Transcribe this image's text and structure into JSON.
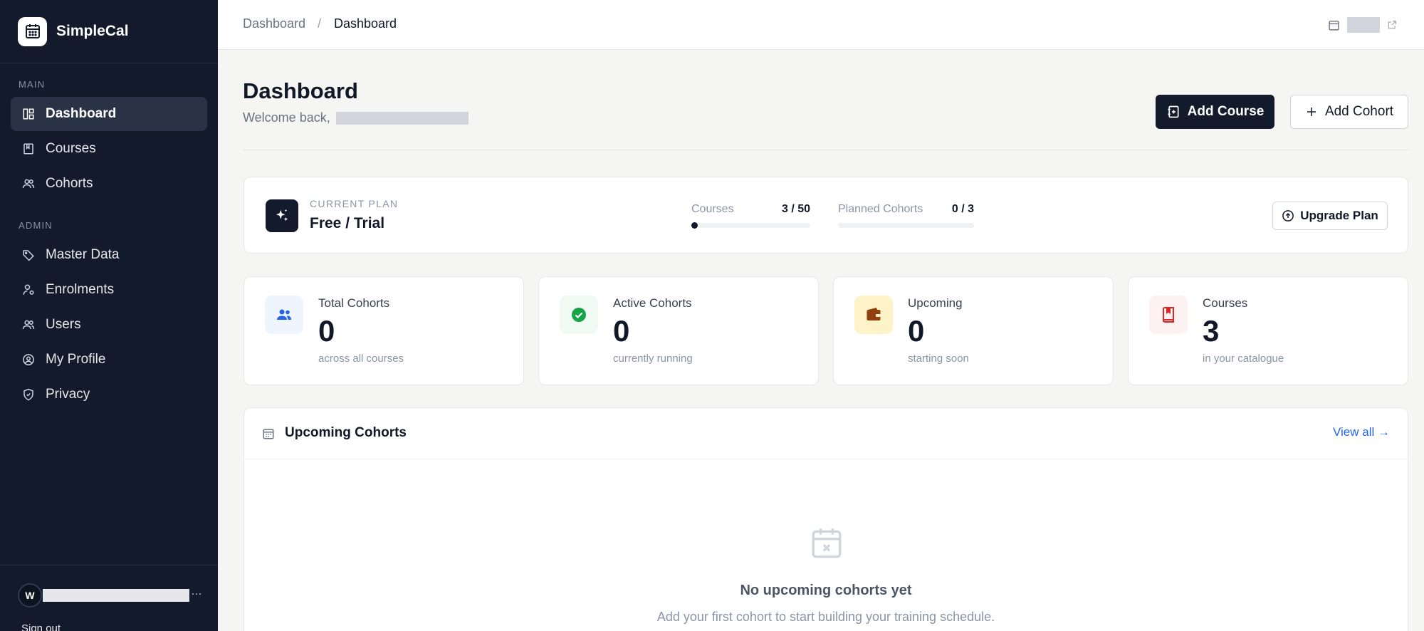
{
  "app": {
    "name": "SimpleCal"
  },
  "sidebar": {
    "sections": {
      "main": "MAIN",
      "admin": "ADMIN"
    },
    "main_items": [
      {
        "label": "Dashboard",
        "icon": "layout-dashboard-icon",
        "active": true
      },
      {
        "label": "Courses",
        "icon": "book-icon"
      },
      {
        "label": "Cohorts",
        "icon": "users-icon"
      }
    ],
    "admin_items": [
      {
        "label": "Master Data",
        "icon": "tag-icon"
      },
      {
        "label": "Enrolments",
        "icon": "user-check-icon"
      },
      {
        "label": "Users",
        "icon": "users-icon"
      },
      {
        "label": "My Profile",
        "icon": "user-circle-icon"
      },
      {
        "label": "Privacy",
        "icon": "shield-icon"
      }
    ],
    "user": {
      "initial": "W",
      "ellipsis": "…"
    },
    "signout_label": "Sign out"
  },
  "topbar": {
    "breadcrumb": [
      "Dashboard",
      "Dashboard"
    ],
    "separator": "/"
  },
  "header": {
    "title": "Dashboard",
    "welcome": "Welcome back,",
    "add_course": "Add Course",
    "add_cohort": "Add Cohort"
  },
  "plan": {
    "label": "CURRENT PLAN",
    "name": "Free / Trial",
    "usage": [
      {
        "name": "Courses",
        "value": "3 / 50",
        "used": 3,
        "max": 50
      },
      {
        "name": "Planned Cohorts",
        "value": "0 / 3",
        "used": 0,
        "max": 3
      }
    ],
    "upgrade_label": "Upgrade Plan"
  },
  "stats": [
    {
      "label": "Total Cohorts",
      "value": "0",
      "sub": "across all courses",
      "icon": "users-icon",
      "color": "#2563eb",
      "bg": "#eff5ff"
    },
    {
      "label": "Active Cohorts",
      "value": "0",
      "sub": "currently running",
      "icon": "check-circle-icon",
      "color": "#16a34a",
      "bg": "#eefaf2"
    },
    {
      "label": "Upcoming",
      "value": "0",
      "sub": "starting soon",
      "icon": "wallet-icon",
      "color": "#92400e",
      "bg": "#fdf3c8"
    },
    {
      "label": "Courses",
      "value": "3",
      "sub": "in your catalogue",
      "icon": "bookmark-book-icon",
      "color": "#dc2626",
      "bg": "#fdf1f1"
    }
  ],
  "upcoming": {
    "title": "Upcoming Cohorts",
    "view_all": "View all →",
    "empty_title": "No upcoming cohorts yet",
    "empty_sub": "Add your first cohort to start building your training schedule."
  }
}
